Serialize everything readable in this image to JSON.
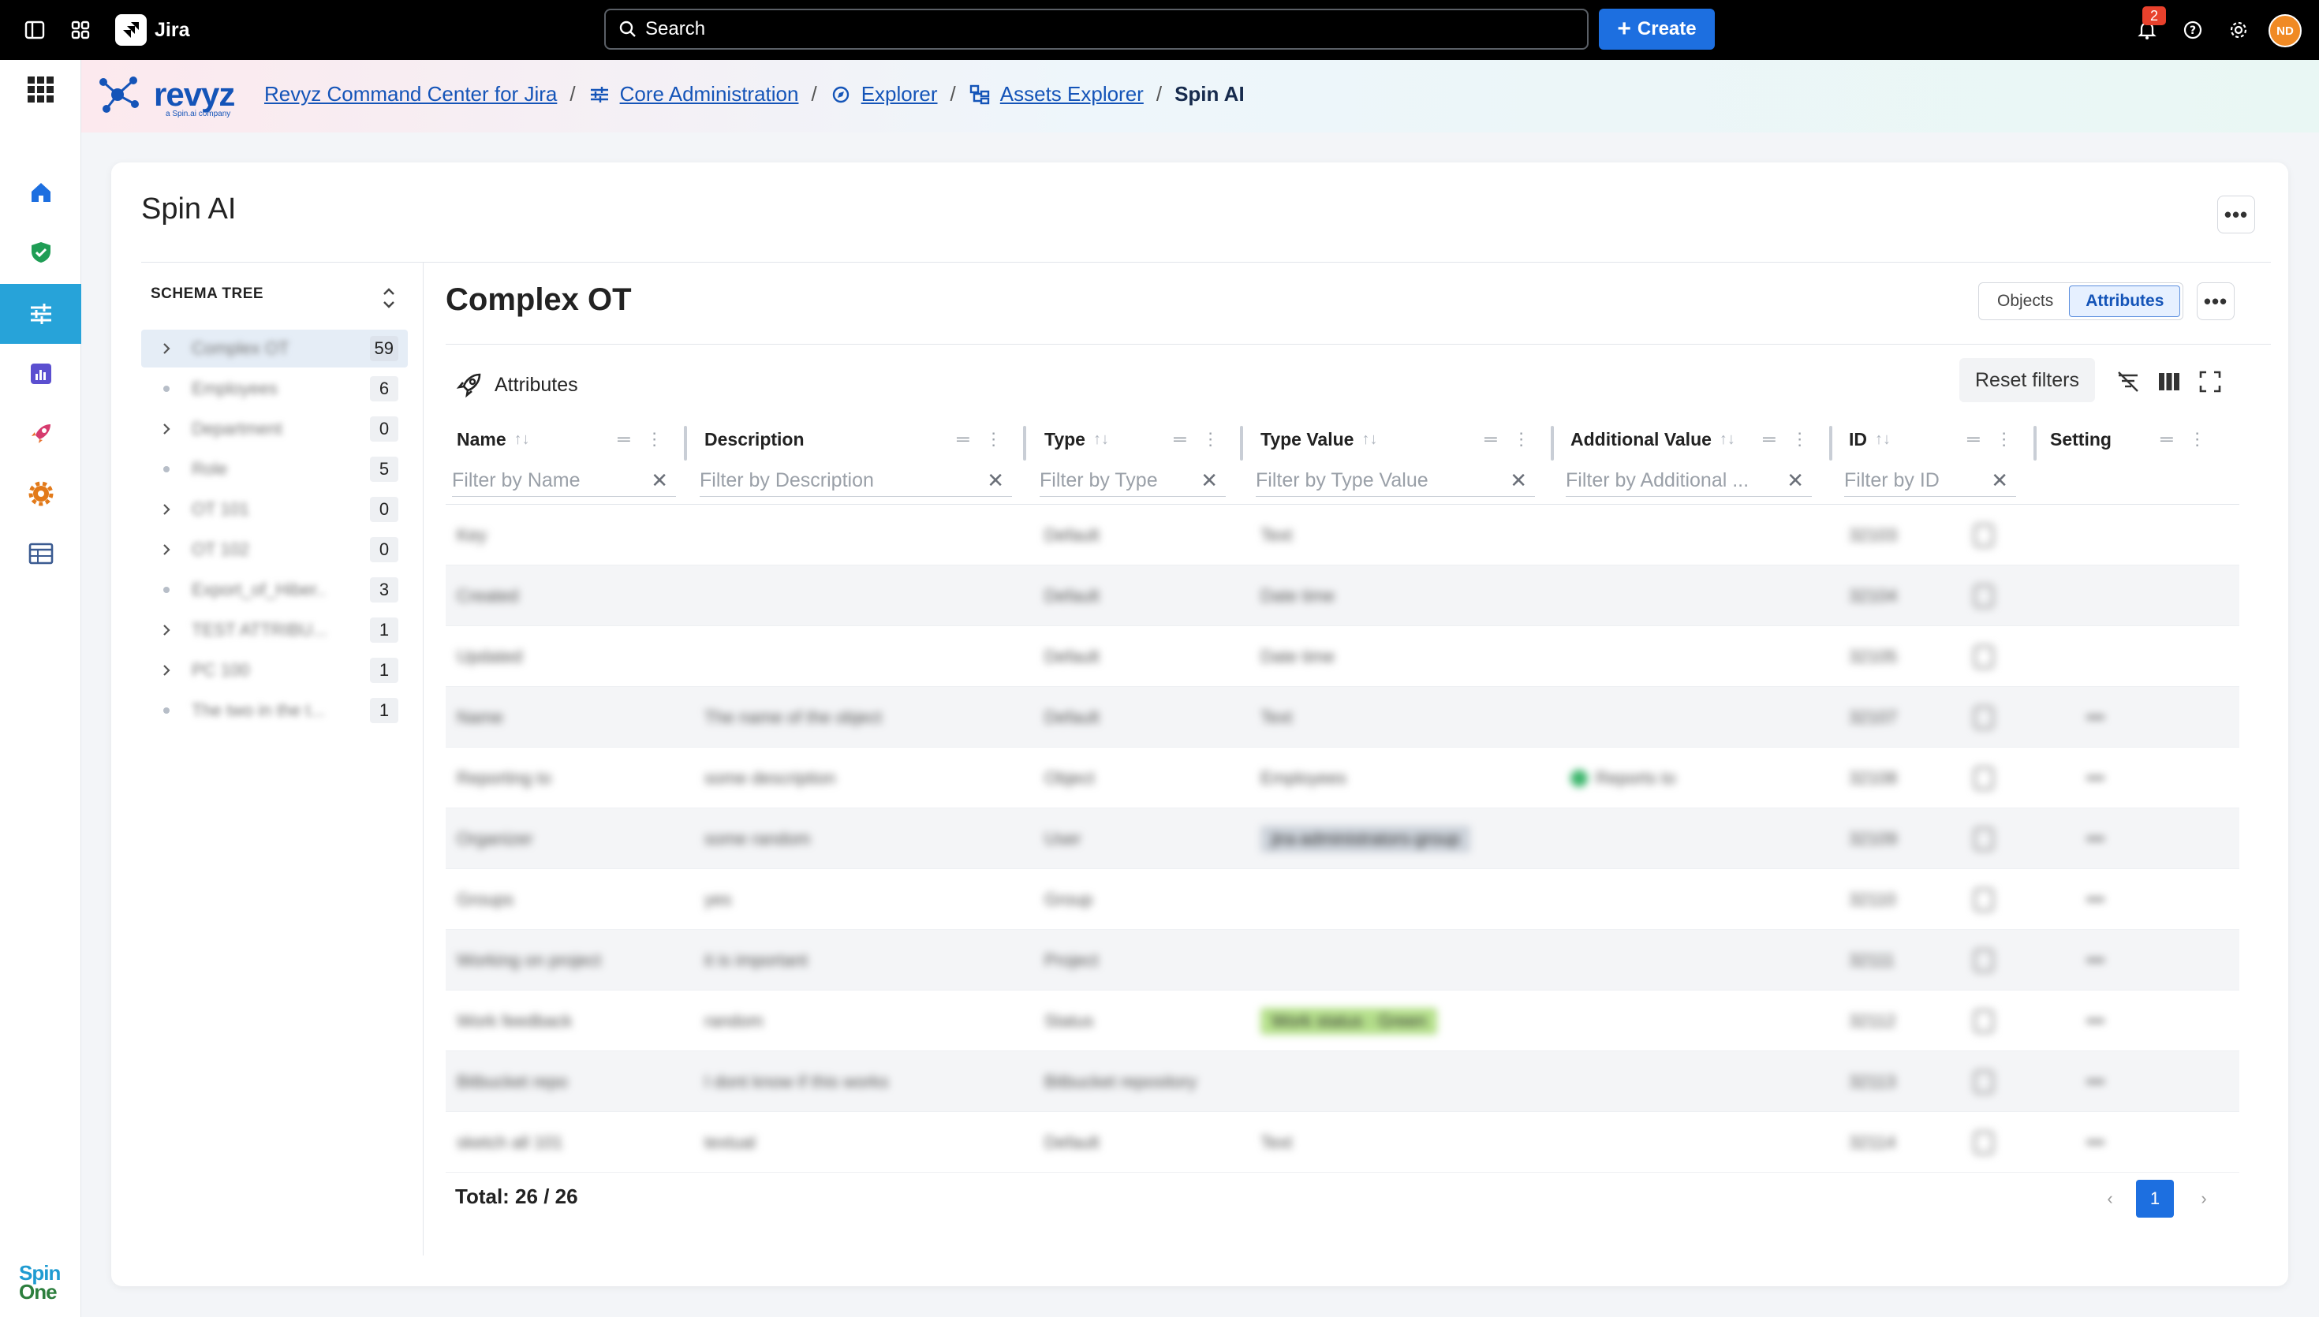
{
  "topbar": {
    "app_name": "Jira",
    "search_placeholder": "Search",
    "create_label": "Create",
    "notification_count": "2",
    "avatar_initials": "ND"
  },
  "nav": {
    "brand": "revyz",
    "brand_sub": "a Spin.ai company",
    "footer_logo_line1": "Spin",
    "footer_logo_line2": "One",
    "items": [
      "home-icon",
      "shield-icon",
      "sliders-icon",
      "chart-icon",
      "rocket-icon",
      "gear-icon",
      "table-icon"
    ],
    "active_index": 2
  },
  "breadcrumb": [
    {
      "label": "Revyz Command Center for Jira",
      "link": true
    },
    {
      "label": "Core Administration",
      "link": true,
      "icon": "sliders-icon"
    },
    {
      "label": "Explorer",
      "link": true,
      "icon": "explorer-icon"
    },
    {
      "label": "Assets Explorer",
      "link": true,
      "icon": "hierarchy-icon"
    },
    {
      "label": "Spin AI",
      "link": false
    }
  ],
  "page": {
    "title": "Spin AI",
    "more": "•••"
  },
  "schema_tree": {
    "header": "SCHEMA TREE",
    "items": [
      {
        "label": "Complex OT",
        "count": "59",
        "expandable": true,
        "selected": true
      },
      {
        "label": "Employees",
        "count": "6",
        "expandable": false
      },
      {
        "label": "Department",
        "count": "0",
        "expandable": true
      },
      {
        "label": "Role",
        "count": "5",
        "expandable": false
      },
      {
        "label": "OT 101",
        "count": "0",
        "expandable": true
      },
      {
        "label": "OT 102",
        "count": "0",
        "expandable": true
      },
      {
        "label": "Export_of_Hiber...",
        "count": "3",
        "expandable": false
      },
      {
        "label": "TEST ATTRIBU...",
        "count": "1",
        "expandable": true
      },
      {
        "label": "PC 100",
        "count": "1",
        "expandable": true
      },
      {
        "label": "The two in the t...",
        "count": "1",
        "expandable": false
      }
    ]
  },
  "content": {
    "title": "Complex OT",
    "view_options": [
      "Objects",
      "Attributes"
    ],
    "active_view": "Attributes",
    "section_label": "Attributes",
    "reset_filters": "Reset filters",
    "total_label": "Total: 26 / 26",
    "current_page": "1"
  },
  "table": {
    "columns": [
      {
        "label": "Name",
        "filter": "Filter by Name"
      },
      {
        "label": "Description",
        "filter": "Filter by Description"
      },
      {
        "label": "Type",
        "filter": "Filter by Type"
      },
      {
        "label": "Type Value",
        "filter": "Filter by Type Value"
      },
      {
        "label": "Additional Value",
        "filter": "Filter by Additional ..."
      },
      {
        "label": "ID",
        "filter": "Filter by ID"
      },
      {
        "label": "Setting",
        "filter": ""
      }
    ],
    "rows": [
      {
        "name": "Key",
        "desc": "",
        "type": "Default",
        "type_value": "Text",
        "add": "",
        "id": "32103",
        "setting": ""
      },
      {
        "name": "Created",
        "desc": "",
        "type": "Default",
        "type_value": "Date time",
        "add": "",
        "id": "32104",
        "setting": ""
      },
      {
        "name": "Updated",
        "desc": "",
        "type": "Default",
        "type_value": "Date time",
        "add": "",
        "id": "32105",
        "setting": ""
      },
      {
        "name": "Name",
        "desc": "The name of the object",
        "type": "Default",
        "type_value": "Text",
        "add": "",
        "id": "32107",
        "setting": "•••"
      },
      {
        "name": "Reporting to",
        "desc": "some description",
        "type": "Object",
        "type_value": "Employees",
        "add": "Reports to",
        "id": "32108",
        "setting": "•••"
      },
      {
        "name": "Organizer",
        "desc": "some random",
        "type": "User",
        "type_value": "jira-administrators-group",
        "add": "",
        "id": "32109",
        "setting": "•••"
      },
      {
        "name": "Groups",
        "desc": "yes",
        "type": "Group",
        "type_value": "",
        "add": "",
        "id": "32110",
        "setting": "•••"
      },
      {
        "name": "Working on project",
        "desc": "it is important",
        "type": "Project",
        "type_value": "",
        "add": "",
        "id": "32111",
        "setting": "•••"
      },
      {
        "name": "Work feedback",
        "desc": "random",
        "type": "Status",
        "type_value": "Work status · Green",
        "add": "",
        "id": "32112",
        "setting": "•••"
      },
      {
        "name": "Bitbucket repo",
        "desc": "I dont know if this works",
        "type": "Bitbucket repository",
        "type_value": "",
        "add": "",
        "id": "32113",
        "setting": "•••"
      },
      {
        "name": "sketch all 101",
        "desc": "textual",
        "type": "Default",
        "type_value": "Text",
        "add": "",
        "id": "32114",
        "setting": "•••"
      }
    ]
  }
}
